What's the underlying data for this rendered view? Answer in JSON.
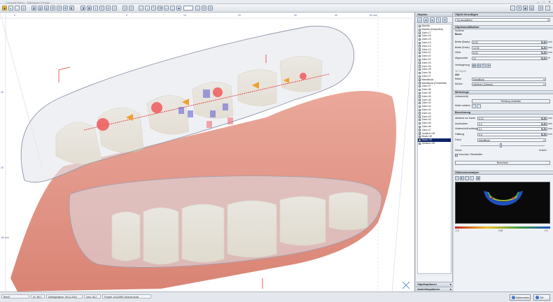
{
  "window": {
    "title": "Ceramill Match - Nightguard Design",
    "minimize": "—",
    "maximize": "□",
    "close": "✕"
  },
  "toolbar": {
    "items": [
      "▣",
      "▸",
      "↔",
      "◎",
      "▦",
      "▧",
      "▤",
      "⊞",
      "⊟",
      "⊠",
      "◧",
      "◨",
      "▩",
      "⌖",
      "⌗",
      "⊕",
      "⊖",
      "⟲",
      "⟳",
      "◐",
      "◑",
      "✎",
      "⌫",
      "▭",
      "▯",
      "◆",
      "◇",
      "☰",
      "⚙"
    ],
    "zoom_value": "",
    "right_items": [
      "⌂",
      "⚙",
      "▣",
      "▤",
      "⊞",
      "?"
    ]
  },
  "viewport": {
    "ruler_top": [
      "0",
      "0",
      "10",
      "20",
      "30",
      "40",
      "50 mm"
    ],
    "ruler_left_top": "40",
    "ruler_left_mid": "20",
    "ruler_left_bottom": "-60 mm"
  },
  "objects_panel": {
    "title": "Objekte",
    "icons": [
      "☐",
      "⇄",
      "⇆",
      "✎",
      "⚙"
    ],
    "items": [
      {
        "label": "Maxilla",
        "checked": true,
        "selected": false
      },
      {
        "label": "Maxilla (Gesichtsb)",
        "checked": false,
        "selected": false
      },
      {
        "label": "Zahn 17",
        "checked": false,
        "selected": false
      },
      {
        "label": "Zahn 16",
        "checked": false,
        "selected": false
      },
      {
        "label": "Zahn 15",
        "checked": false,
        "selected": false
      },
      {
        "label": "Zahn 14",
        "checked": false,
        "selected": false
      },
      {
        "label": "Zahn 13",
        "checked": false,
        "selected": false
      },
      {
        "label": "Zahn 12",
        "checked": false,
        "selected": false
      },
      {
        "label": "Zahn 11",
        "checked": false,
        "selected": false
      },
      {
        "label": "Zahn 21",
        "checked": false,
        "selected": false
      },
      {
        "label": "Zahn 22",
        "checked": false,
        "selected": false
      },
      {
        "label": "Zahn 23",
        "checked": false,
        "selected": false
      },
      {
        "label": "Zahn 24",
        "checked": false,
        "selected": false
      },
      {
        "label": "Zahn 25",
        "checked": false,
        "selected": false
      },
      {
        "label": "Zahn 26",
        "checked": false,
        "selected": false
      },
      {
        "label": "Zahn 27",
        "checked": false,
        "selected": false
      },
      {
        "label": "Mandibula",
        "checked": true,
        "selected": false
      },
      {
        "label": "Mandibula (Gesichtsb)",
        "checked": false,
        "selected": false
      },
      {
        "label": "Zahn 37",
        "checked": false,
        "selected": false
      },
      {
        "label": "Zahn 36",
        "checked": false,
        "selected": false
      },
      {
        "label": "Zahn 35",
        "checked": false,
        "selected": false
      },
      {
        "label": "Zahn 34",
        "checked": false,
        "selected": false
      },
      {
        "label": "Zahn 33",
        "checked": false,
        "selected": false
      },
      {
        "label": "Zahn 32",
        "checked": false,
        "selected": false
      },
      {
        "label": "Zahn 31",
        "checked": false,
        "selected": false
      },
      {
        "label": "Zahn 41",
        "checked": false,
        "selected": false
      },
      {
        "label": "Zahn 42",
        "checked": false,
        "selected": false
      },
      {
        "label": "Zahn 43",
        "checked": false,
        "selected": false
      },
      {
        "label": "Zahn 44",
        "checked": false,
        "selected": false
      },
      {
        "label": "Zahn 45",
        "checked": false,
        "selected": false
      },
      {
        "label": "Zahn 46",
        "checked": false,
        "selected": false
      },
      {
        "label": "Zahn 47",
        "checked": false,
        "selected": false
      },
      {
        "label": "Schiene UK",
        "checked": true,
        "selected": false
      },
      {
        "label": "Block UK",
        "checked": true,
        "selected": false
      },
      {
        "label": "Block OK",
        "checked": true,
        "selected": true
      },
      {
        "label": "Schiene OK",
        "checked": true,
        "selected": false
      }
    ],
    "footer": "1 Objekt (e.1.00 e.0.106)"
  },
  "collapsed_panels": [
    {
      "label": "Objektoptionen"
    },
    {
      "label": "Ansichtsoptionen"
    }
  ],
  "right_panel": {
    "add_object": {
      "title": "Objekt hinzufügen",
      "type_label": "Typ auswählen"
    },
    "modification": {
      "title": "Objektmodifikation",
      "subtitle": "Schiene",
      "block_label": "Block",
      "fields": [
        {
          "label": "Breite (Basis)",
          "value": "8,00",
          "unit": "mm"
        },
        {
          "label": "Breite (Ende)",
          "value": "12,00",
          "unit": "mm"
        },
        {
          "label": "Höhe",
          "value": "8,00",
          "unit": "mm"
        },
        {
          "label": "Abgerundet",
          "value": "10",
          "unit": "%"
        }
      ],
      "position_label": "Verlängerung",
      "section_3d": "3D Objekt",
      "all_label": "Alle",
      "reihe_label": "Reihe",
      "reihe_value": "Mandibula",
      "modus_label": "Modus",
      "modus_value": "Addieren (Zahnen)"
    },
    "tools": {
      "title": "Werkzeuge",
      "unterschnitt_label": "Unterschnitt",
      "unterschnitt_button": "Richtung einstellen",
      "rotation_label": "Kiefer rotation",
      "rotation_plus": "+",
      "rotation_minus": "−"
    },
    "calculation": {
      "title": "Berechnung",
      "fields": [
        {
          "label": "Abstand zur Kante",
          "value": "0,10",
          "unit": "mm"
        },
        {
          "label": "Ausblocken",
          "value": "0,0",
          "unit": "mm"
        },
        {
          "label": "Unterschnitt zulässig",
          "value": "0,1",
          "unit": "mm"
        },
        {
          "label": "Glättung",
          "value": "0,0",
          "unit": "mm"
        }
      ],
      "fixed_label": "Fixed",
      "fixed_value": "Mandibula",
      "slider_left": "Genau",
      "slider_right": "Schnell",
      "checkbox_label": "Vorschau / Bearbeiten",
      "calc_button": "Berechnen"
    },
    "distance": {
      "title": "Okklusionsanalyse",
      "icons": [
        "◫",
        "◧",
        "▢",
        "◐",
        "▦"
      ],
      "legend_left": "-1.0",
      "legend_mid": "1.00",
      "legend_right": "1.0",
      "legend_colors": [
        "#c8202a",
        "#f0c020",
        "#44a040",
        "#2050c0"
      ]
    }
  },
  "status": {
    "ready": "Bereit",
    "id": "ID: 3517",
    "date": "Auftragsdatum: 08.11.2016",
    "version": "Vers: 36.2",
    "project": "Projekt: 10116950 Schiene dicke",
    "ok": "OK",
    "cancel": "Abbrechen"
  }
}
